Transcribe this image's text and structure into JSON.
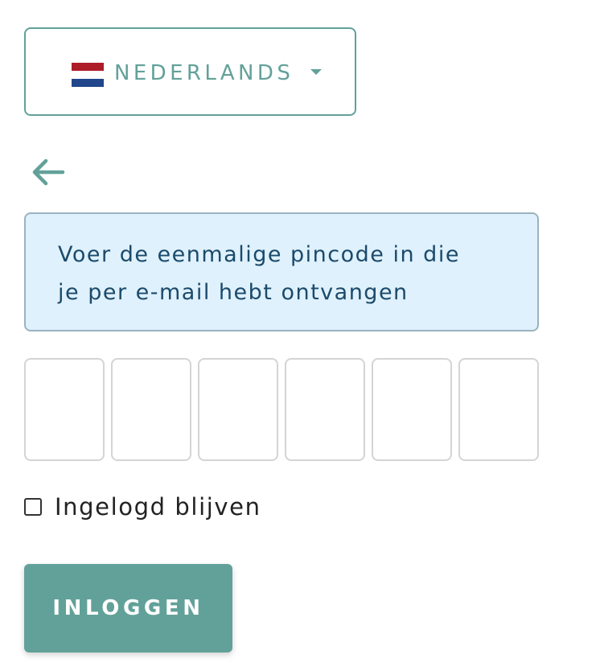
{
  "language_selector": {
    "label": "NEDERLANDS",
    "flag_icon": "flag-netherlands-icon",
    "caret_icon": "caret-down-icon",
    "flag_colors": [
      "#ae1c28",
      "#ffffff",
      "#21468b"
    ]
  },
  "back_button": {
    "icon": "arrow-left-icon"
  },
  "info_message": {
    "line1": "Voer de eenmalige pincode in die",
    "line2": "je per e-mail hebt ontvangen"
  },
  "pin_inputs": [
    "",
    "",
    "",
    "",
    "",
    ""
  ],
  "remember_me": {
    "label": "Ingelogd blijven",
    "checked": false
  },
  "login_button": {
    "label": "INLOGGEN"
  },
  "colors": {
    "accent": "#62a199",
    "info_background": "#dff1fc",
    "info_text": "#1b4a6b"
  }
}
